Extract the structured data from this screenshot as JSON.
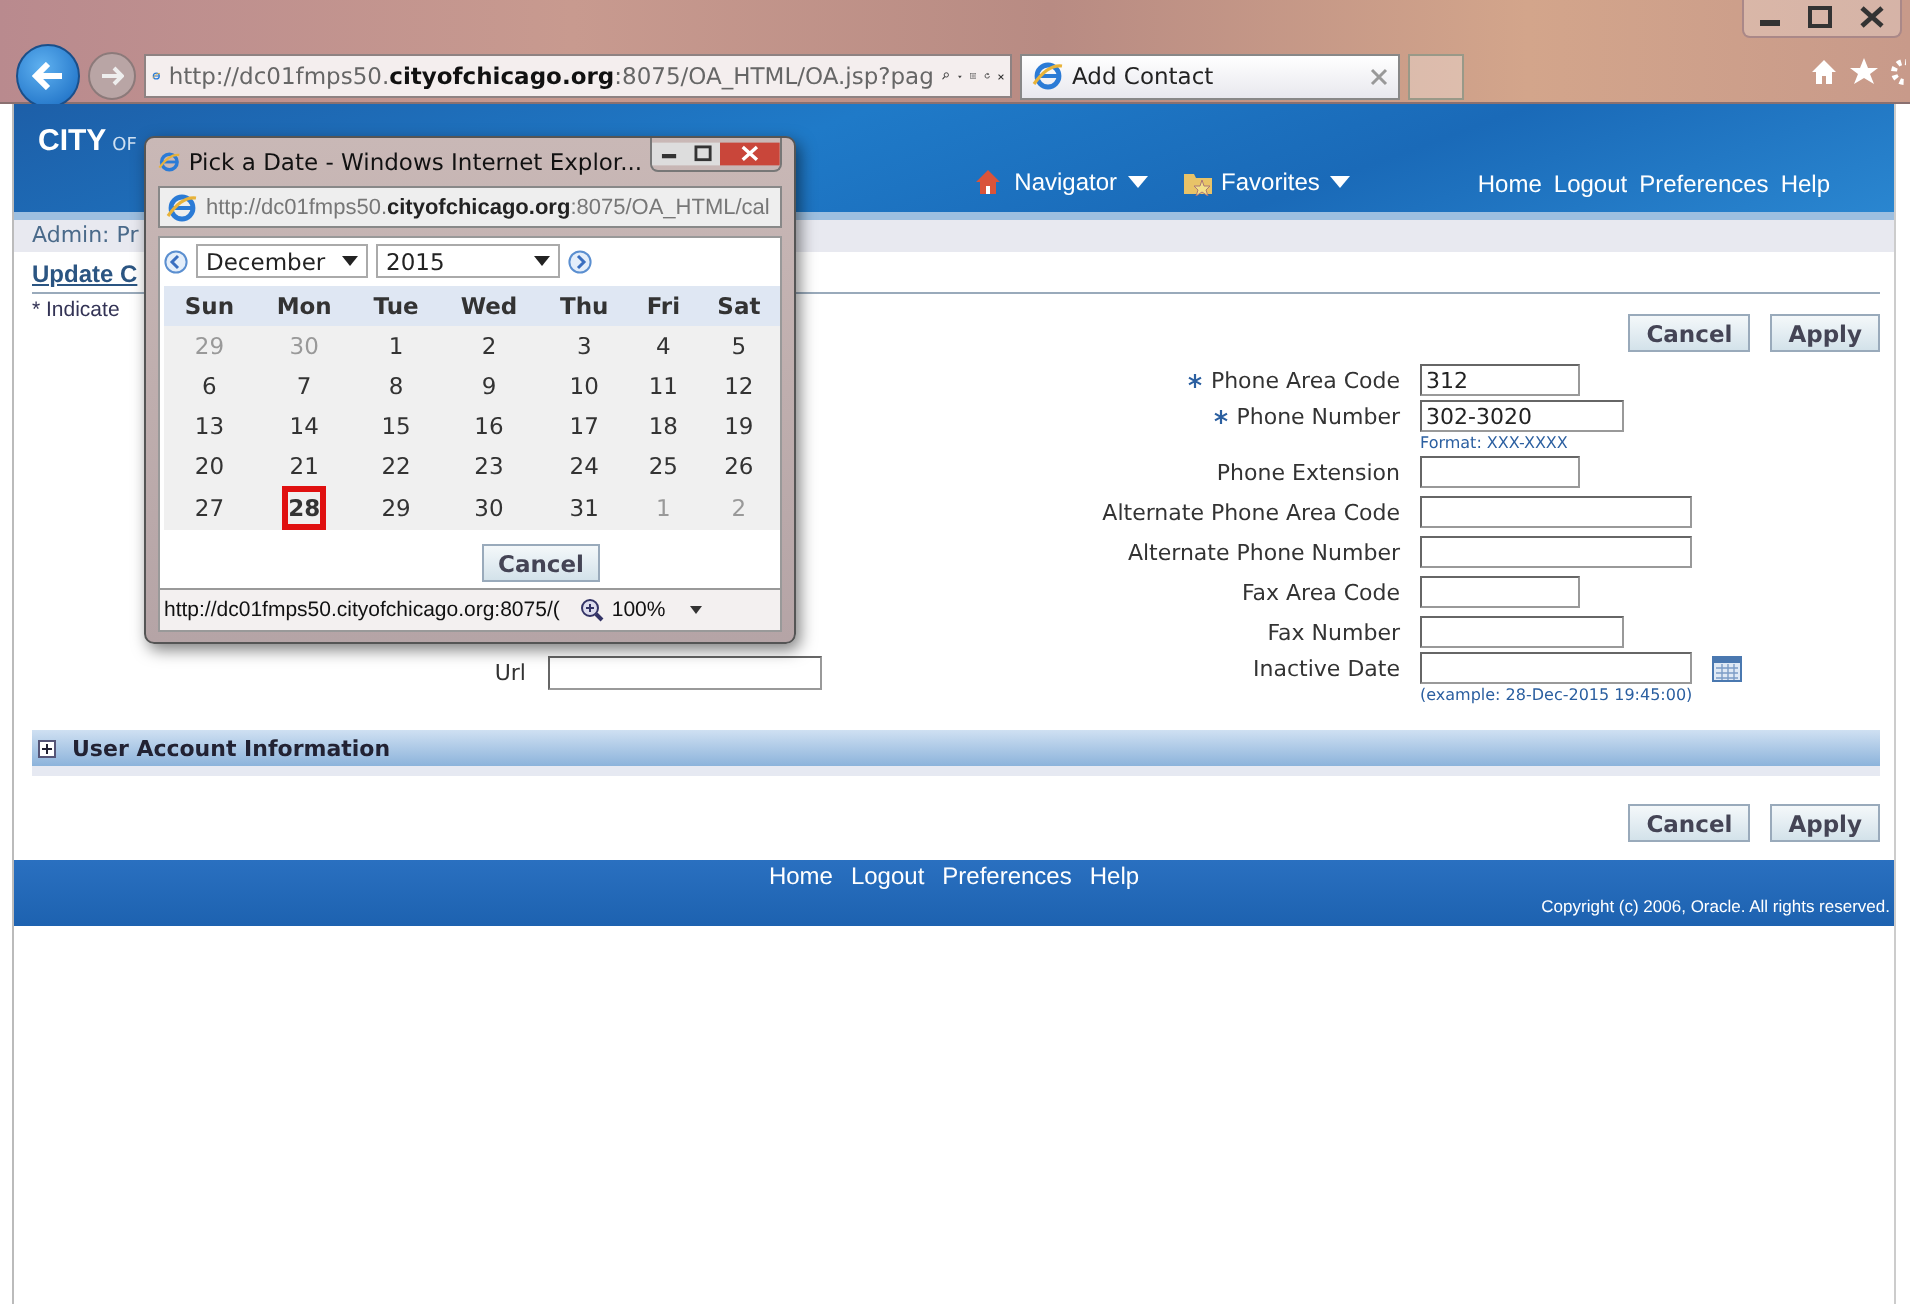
{
  "browser": {
    "address": "http://dc01fmps50.**cityofchicago.org**:8075/OA_HTML/OA.jsp?pag",
    "tab_title": "Add Contact"
  },
  "header": {
    "logo": [
      "CITY",
      "OF"
    ],
    "menus": [
      {
        "label": "Navigator"
      },
      {
        "label": "Favorites"
      }
    ],
    "links": [
      "Home",
      "Logout",
      "Preferences",
      "Help"
    ]
  },
  "breadcrumb": "Admin: Pr",
  "page_title": "Update C",
  "required_note": "* Indicate",
  "left_fields": [
    {
      "label": "Url"
    }
  ],
  "top_buttons": [
    "Cancel",
    "Apply"
  ],
  "fields": [
    {
      "label": "Phone Area Code",
      "required": true,
      "value": "312",
      "kind": "text"
    },
    {
      "label": "Phone Number",
      "required": true,
      "value": "302-3020",
      "hint": "Format: XXX-XXXX",
      "kind": "text"
    },
    {
      "label": "Phone Extension",
      "required": false,
      "kind": "text"
    },
    {
      "label": "Alternate Phone Area Code",
      "required": false,
      "kind": "text"
    },
    {
      "label": "Alternate Phone Number",
      "required": false,
      "kind": "text"
    },
    {
      "label": "Fax Area Code",
      "required": false,
      "kind": "text"
    },
    {
      "label": "Fax Number",
      "required": false,
      "kind": "text"
    },
    {
      "label": "Inactive Date",
      "required": false,
      "hint": "(example: 28-Dec-2015 19:45:00)",
      "kind": "date"
    }
  ],
  "section": {
    "title": "User Account Information",
    "expanded": false
  },
  "bottom_buttons": [
    "Cancel",
    "Apply"
  ],
  "footer": {
    "links": [
      "Home",
      "Logout",
      "Preferences",
      "Help"
    ],
    "copyright": "Copyright (c) 2006, Oracle. All rights reserved."
  },
  "popup": {
    "title": "Pick a Date - Windows Internet Explor...",
    "address": "http://dc01fmps50.**cityofchicago.org**:8075/OA_HTML/cal",
    "month": "December",
    "year": "2015",
    "weekdays": [
      "Sun",
      "Mon",
      "Tue",
      "Wed",
      "Thu",
      "Fri",
      "Sat"
    ],
    "weeks": [
      [
        {
          "day": "29",
          "other_month": true,
          "selected": false
        },
        {
          "day": "30",
          "other_month": true,
          "selected": false
        },
        {
          "day": "1",
          "other_month": false,
          "selected": false
        },
        {
          "day": "2",
          "other_month": false,
          "selected": false
        },
        {
          "day": "3",
          "other_month": false,
          "selected": false
        },
        {
          "day": "4",
          "other_month": false,
          "selected": false
        },
        {
          "day": "5",
          "other_month": false,
          "selected": false
        }
      ],
      [
        {
          "day": "6",
          "other_month": false,
          "selected": false
        },
        {
          "day": "7",
          "other_month": false,
          "selected": false
        },
        {
          "day": "8",
          "other_month": false,
          "selected": false
        },
        {
          "day": "9",
          "other_month": false,
          "selected": false
        },
        {
          "day": "10",
          "other_month": false,
          "selected": false
        },
        {
          "day": "11",
          "other_month": false,
          "selected": false
        },
        {
          "day": "12",
          "other_month": false,
          "selected": false
        }
      ],
      [
        {
          "day": "13",
          "other_month": false,
          "selected": false
        },
        {
          "day": "14",
          "other_month": false,
          "selected": false
        },
        {
          "day": "15",
          "other_month": false,
          "selected": false
        },
        {
          "day": "16",
          "other_month": false,
          "selected": false
        },
        {
          "day": "17",
          "other_month": false,
          "selected": false
        },
        {
          "day": "18",
          "other_month": false,
          "selected": false
        },
        {
          "day": "19",
          "other_month": false,
          "selected": false
        }
      ],
      [
        {
          "day": "20",
          "other_month": false,
          "selected": false
        },
        {
          "day": "21",
          "other_month": false,
          "selected": false
        },
        {
          "day": "22",
          "other_month": false,
          "selected": false
        },
        {
          "day": "23",
          "other_month": false,
          "selected": false
        },
        {
          "day": "24",
          "other_month": false,
          "selected": false
        },
        {
          "day": "25",
          "other_month": false,
          "selected": false
        },
        {
          "day": "26",
          "other_month": false,
          "selected": false
        }
      ],
      [
        {
          "day": "27",
          "other_month": false,
          "selected": false
        },
        {
          "day": "28",
          "other_month": false,
          "selected": true
        },
        {
          "day": "29",
          "other_month": false,
          "selected": false
        },
        {
          "day": "30",
          "other_month": false,
          "selected": false
        },
        {
          "day": "31",
          "other_month": false,
          "selected": false
        },
        {
          "day": "1",
          "other_month": true,
          "selected": false
        },
        {
          "day": "2",
          "other_month": true,
          "selected": false
        }
      ]
    ],
    "cancel": "Cancel",
    "status_url": "http://dc01fmps50.cityofchicago.org:8075/(",
    "zoom": "100%"
  }
}
